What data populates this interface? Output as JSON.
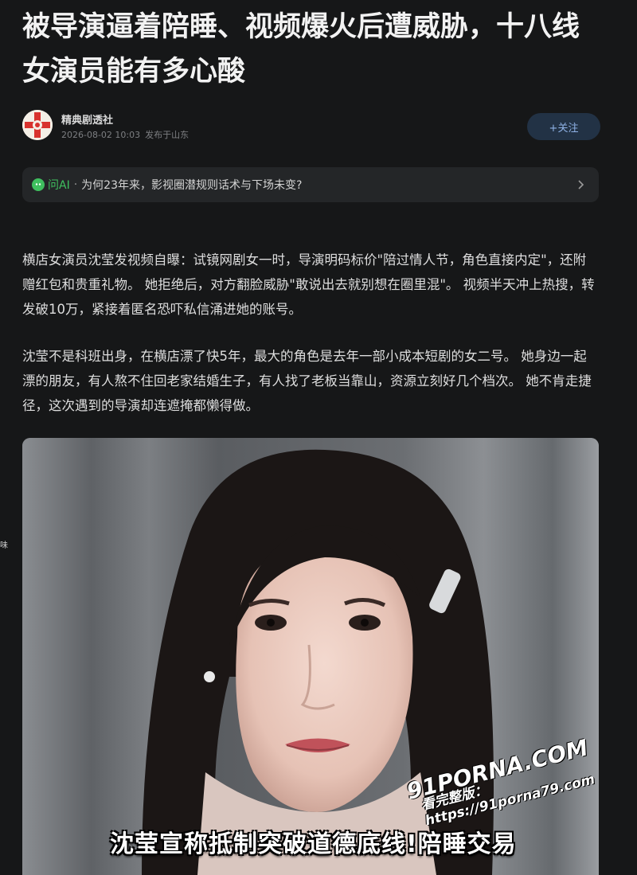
{
  "article": {
    "title": "被导演逼着陪睡、视频爆火后遭威胁，十八线女演员能有多心酸"
  },
  "author": {
    "name": "精典剧透社",
    "date": "2026-08-02 10:03",
    "location": "发布于山东",
    "follow_label": "+关注"
  },
  "ask_ai": {
    "label": "问AI",
    "separator": "·",
    "question": "为何23年来，影视圈潜规则话术与下场未变?"
  },
  "body": {
    "paragraphs": [
      "横店女演员沈莹发视频自曝：试镜网剧女一时，导演明码标价\"陪过情人节，角色直接内定\"，还附赠红包和贵重礼物。 她拒绝后，对方翻脸威胁\"敢说出去就别想在圈里混\"。 视频半天冲上热搜，转发破10万，紧接着匿名恐吓私信涌进她的账号。",
      "沈莹不是科班出身，在横店漂了快5年，最大的角色是去年一部小成本短剧的女二号。 她身边一起漂的朋友，有人熬不住回老家结婚生子，有人找了老板当靠山，资源立刻好几个档次。 她不肯走捷径，这次遇到的导演却连遮掩都懒得做。"
    ]
  },
  "video": {
    "subtitle": "沈莹宣称抵制突破道德底线!陪睡交易",
    "watermark_logo": "91PORNA.COM",
    "watermark_url": "看完整版：https://91porna79.com"
  },
  "edge_glyph": "味",
  "icons": {
    "avatar": "author-avatar",
    "ai_logo": "ai-logo-icon",
    "chevron": "chevron-right-icon"
  },
  "colors": {
    "background": "#161718",
    "ai_green": "#3fbf5f",
    "follow_bg": "#223245",
    "follow_text": "#8fb2e6"
  }
}
